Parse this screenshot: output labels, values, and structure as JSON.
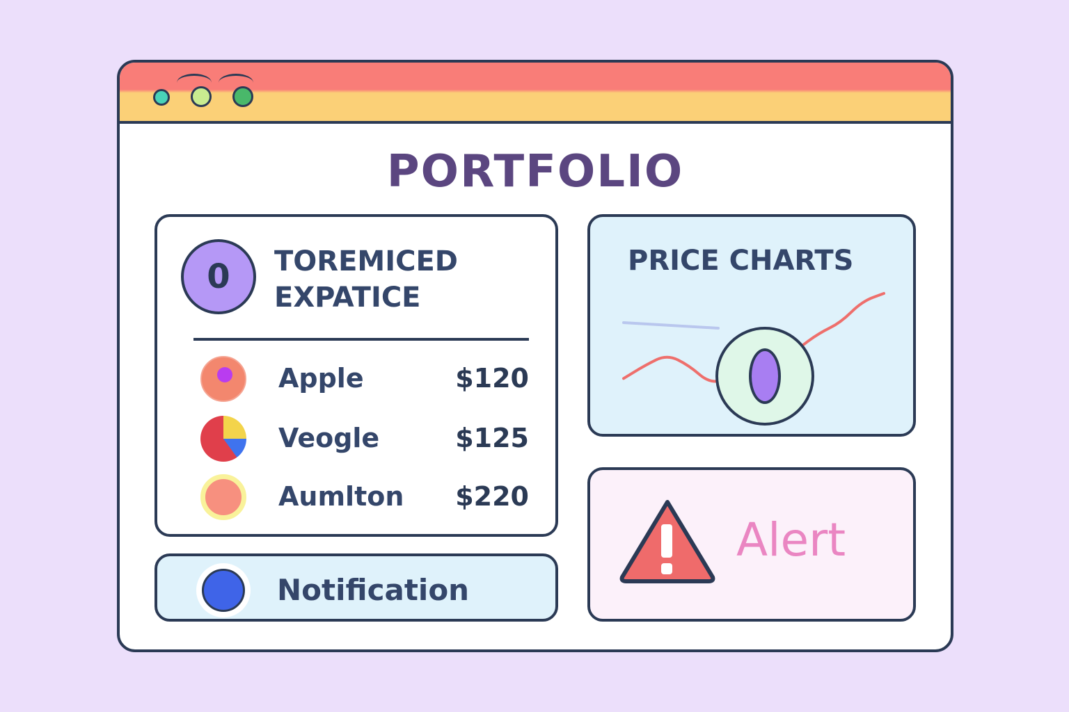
{
  "app": {
    "title": "PORTFOLIO",
    "colors": {
      "titlebar_top": "#f97d78",
      "titlebar_bottom": "#fbd077",
      "background": "#ecdffb",
      "outline": "#2b3a55"
    }
  },
  "window_controls": [
    "teal-dot",
    "lime-dot",
    "green-dot"
  ],
  "holdings": {
    "badge": "0",
    "title_line1": "TOREMICED",
    "title_line2": "EXPATICE",
    "items": [
      {
        "name": "Apple",
        "price": "$120",
        "icon": "apple-logo-icon"
      },
      {
        "name": "Veogle",
        "price": "$125",
        "icon": "veogle-logo-icon"
      },
      {
        "name": "Aumlton",
        "price": "$220",
        "icon": "aumlton-logo-icon"
      }
    ]
  },
  "notification": {
    "label": "Notification",
    "icon": "blue-dot-icon"
  },
  "price_charts": {
    "title": "PRICE CHARTS",
    "chart_data": {
      "type": "line",
      "title": "",
      "xlabel": "",
      "ylabel": "",
      "series": [
        {
          "values": [
            12,
            22,
            30,
            22,
            8,
            13,
            28,
            18,
            34,
            46,
            54,
            70,
            76
          ]
        }
      ],
      "grid": false,
      "color": "#ee6f6c"
    }
  },
  "float_badge": {
    "icon": "zero-badge-icon"
  },
  "alert": {
    "label": "Alert",
    "icon": "warning-triangle-icon",
    "color": "#ea86c2"
  }
}
